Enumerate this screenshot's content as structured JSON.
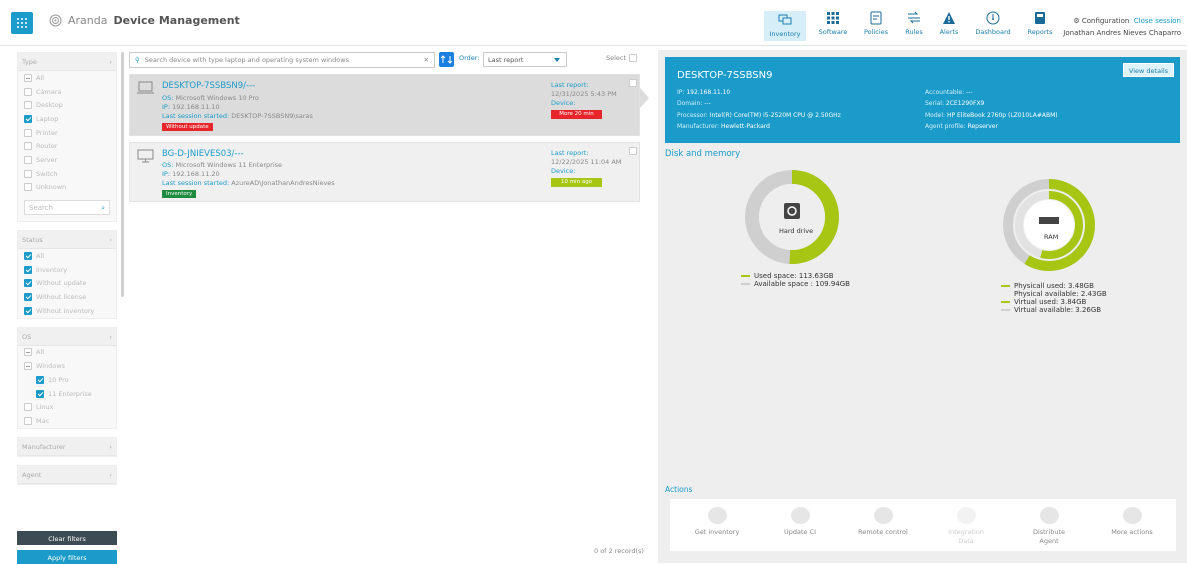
{
  "app": {
    "brand_prefix": "Aranda",
    "brand_bold": "Device Management"
  },
  "nav": [
    {
      "label": "Inventory",
      "icon": "inventory-icon",
      "active": true
    },
    {
      "label": "Software",
      "icon": "grid-icon"
    },
    {
      "label": "Policies",
      "icon": "policies-icon"
    },
    {
      "label": "Rules",
      "icon": "rules-icon"
    },
    {
      "label": "Alerts",
      "icon": "alert-icon"
    },
    {
      "label": "Dashboard",
      "icon": "dashboard-icon"
    },
    {
      "label": "Reports",
      "icon": "reports-icon"
    }
  ],
  "header": {
    "configuration": "Configuration",
    "close_session": "Close session",
    "user": "Jonathan Andres Nieves Chaparro"
  },
  "filters": {
    "type": {
      "title": "Type",
      "items": [
        "All",
        "Cámara",
        "Desktop",
        "Laptop",
        "Printer",
        "Router",
        "Server",
        "Switch",
        "Unknown"
      ],
      "search_placeholder": "Search"
    },
    "status": {
      "title": "Status",
      "items": [
        "All",
        "Inventory",
        "Without update",
        "Without license",
        "Without inventory"
      ]
    },
    "os": {
      "title": "OS",
      "items": [
        "All",
        "Windows",
        "10 Pro",
        "11 Enterprise",
        "Linux",
        "Mac"
      ]
    },
    "manufacturer": {
      "title": "Manufacturer"
    },
    "agent": {
      "title": "Agent"
    },
    "clear_label": "Clear filters",
    "apply_label": "Apply filters"
  },
  "list": {
    "search_placeholder": "Search device with type laptop and operating system windows",
    "order_label": "Order:",
    "order_value": "Last report",
    "select_label": "Select",
    "records": "0 of 2 record(s)",
    "devices": [
      {
        "name": "DESKTOP-7SSBSN9/---",
        "os_label": "OS:",
        "os": "Microsoft Windows 10 Pro",
        "ip_label": "IP:",
        "ip": "192.168.11.10",
        "session_label": "Last session started:",
        "session": "DESKTOP-7SSBSN9\\saras",
        "tag": "Without update",
        "report_label": "Last report:",
        "report_date": "12/31/2025 5:43 PM",
        "device_label": "Device:",
        "device_tag": "More 20 min"
      },
      {
        "name": "BG-D-JNIEVES03/---",
        "os_label": "OS:",
        "os": "Microsoft Windows 11 Enterprise",
        "ip_label": "IP:",
        "ip": "192.168.11.20",
        "session_label": "Last session started:",
        "session": "AzureAD\\JonathanAndresNieves",
        "tag": "Inventory",
        "report_label": "Last report:",
        "report_date": "12/22/2025 11:04 AM",
        "device_label": "Device:",
        "device_tag": "10 min ago"
      }
    ]
  },
  "detail": {
    "title": "DESKTOP-7SSBSN9",
    "view_details": "View details",
    "ip_label": "IP:",
    "ip": "192.168.11.10",
    "domain_label": "Domain:",
    "domain": "---",
    "processor_label": "Processor:",
    "processor": "Intel(R) Core(TM) i5-2520M CPU @ 2.50GHz",
    "manufacturer_label": "Manufacturer:",
    "manufacturer": "Hewlett-Packard",
    "accountable_label": "Accountable:",
    "accountable": "---",
    "serial_label": "Serial:",
    "serial": "2CE1290FX9",
    "model_label": "Model:",
    "model": "HP EliteBook 2760p (LZ010LA#ABM)",
    "agent_profile_label": "Agent profile:",
    "agent_profile": "Repserver",
    "disk_section": "Disk and memory",
    "disk_label": "Hard drive",
    "disk_used": "Used space: 113.63GB",
    "disk_available": "Available space : 109.94GB",
    "disk_used_fraction": 0.508,
    "ram_label": "RAM",
    "ram_legend": [
      "Physicall used: 3.48GB",
      "Physical available: 2.43GB",
      "Virtual used: 3.84GB",
      "Virtual available: 3.26GB"
    ],
    "ram_physical_fraction": 0.589,
    "ram_virtual_fraction": 0.541,
    "actions_section": "Actions",
    "actions": [
      {
        "label": "Get inventory",
        "enabled": true
      },
      {
        "label": "Update CI",
        "enabled": true
      },
      {
        "label": "Remote control",
        "enabled": true
      },
      {
        "label": "Integration Data",
        "enabled": false
      },
      {
        "label": "Distribute Agent",
        "enabled": true
      },
      {
        "label": "More actions",
        "enabled": true
      }
    ]
  },
  "colors": {
    "accent": "#1a9bc9",
    "green": "#a7c614",
    "red": "#e8252a",
    "gray_ring": "#cfcfcf",
    "dark_btn": "#3d4b55"
  }
}
